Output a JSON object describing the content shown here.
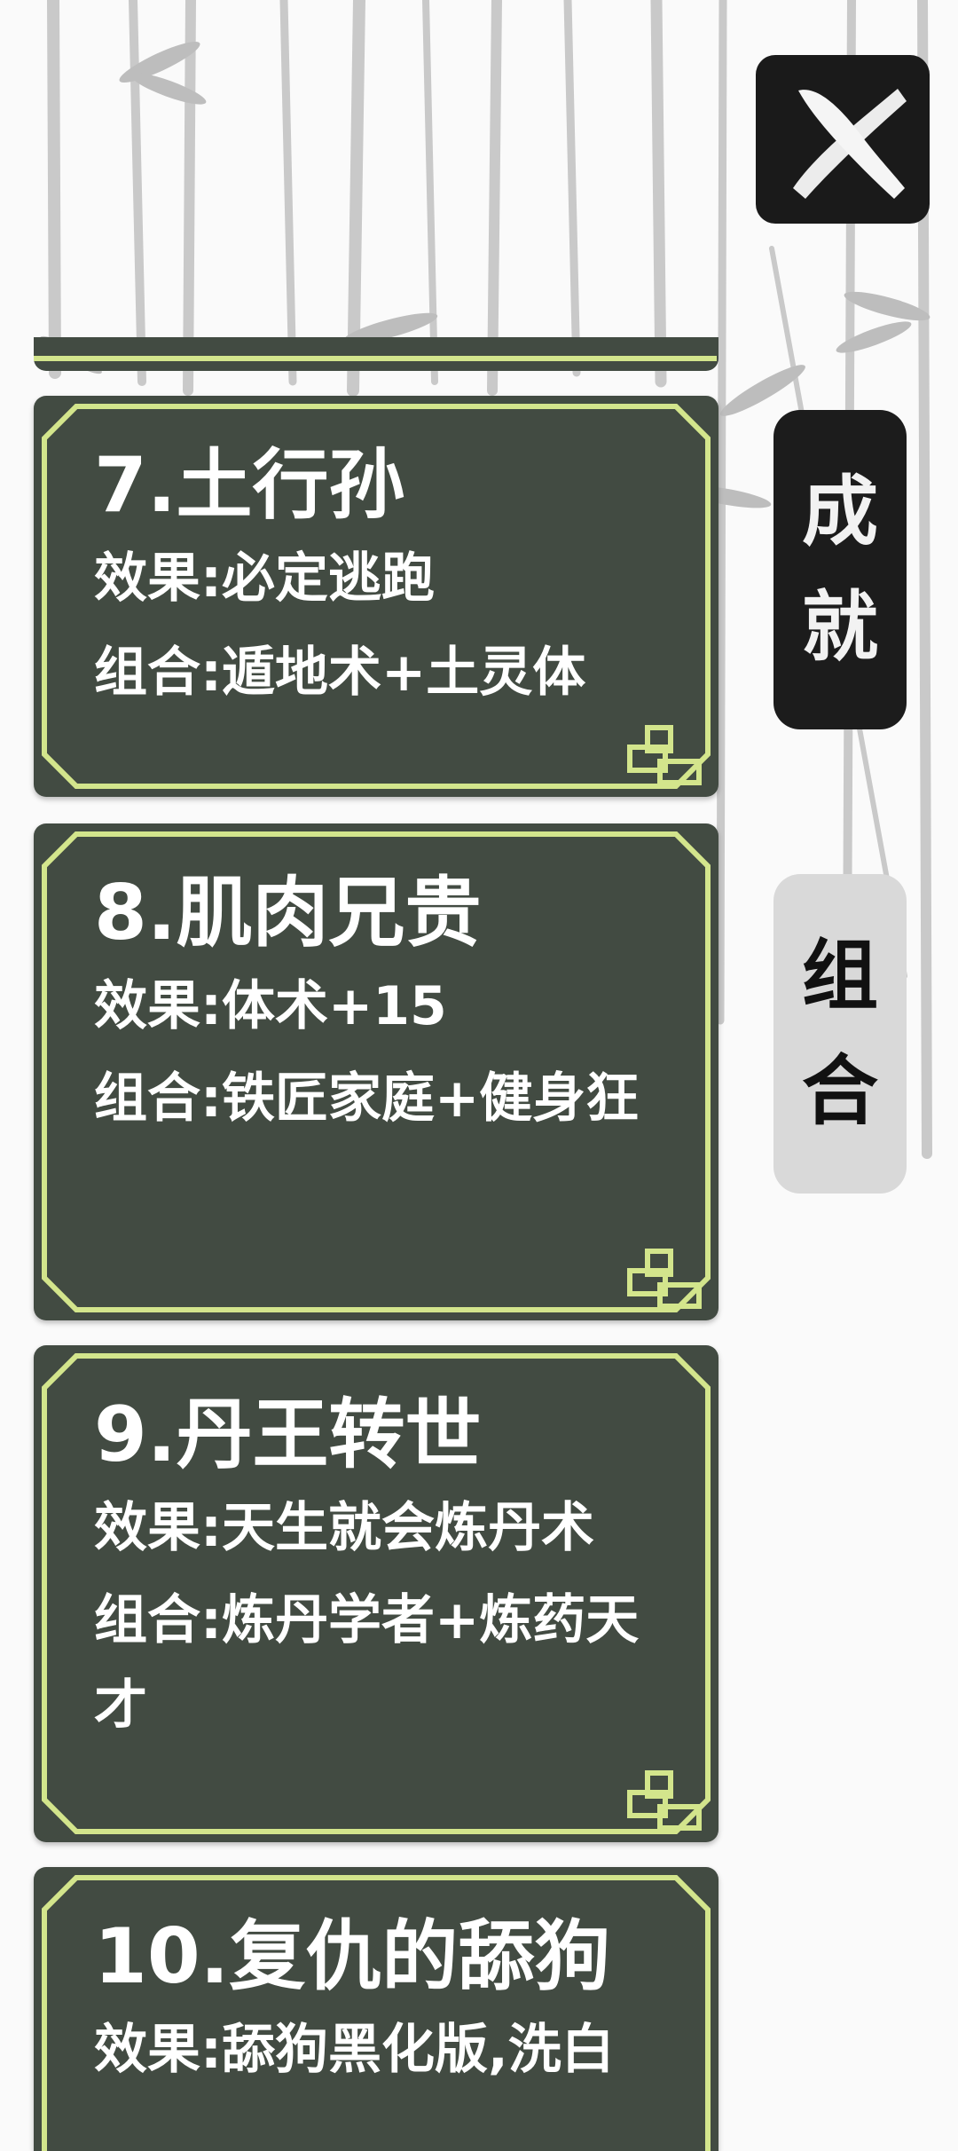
{
  "colors": {
    "card_bg": "#424b42",
    "card_border": "#d3e58c",
    "tab_active_bg": "#d9d9d9",
    "tab_inactive_bg": "#1c1c1c"
  },
  "close_button": {
    "icon": "brush-x-icon"
  },
  "tabs": [
    {
      "label_1": "成",
      "label_2": "就",
      "selected": false
    },
    {
      "label_1": "组",
      "label_2": "合",
      "selected": true
    }
  ],
  "cards": [
    {
      "title": "7.土行孙",
      "effect": "效果:必定逃跑",
      "combo": "组合:遁地术+土灵体"
    },
    {
      "title": "8.肌肉兄贵",
      "effect": "效果:体术+15",
      "combo": "组合:铁匠家庭+健身狂"
    },
    {
      "title": "9.丹王转世",
      "effect": "效果:天生就会炼丹术",
      "combo": "组合:炼丹学者+炼药天才"
    },
    {
      "title": "10.复仇的舔狗",
      "effect": "效果:舔狗黑化版,洗白"
    }
  ]
}
